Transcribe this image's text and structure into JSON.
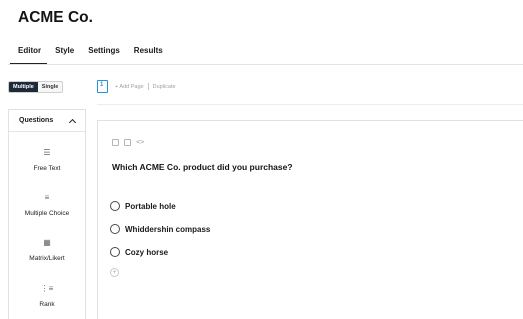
{
  "app": {
    "title": "ACME Co."
  },
  "tabs": [
    {
      "label": "Editor",
      "active": true
    },
    {
      "label": "Style",
      "active": false
    },
    {
      "label": "Settings",
      "active": false
    },
    {
      "label": "Results",
      "active": false
    }
  ],
  "mode_toggle": {
    "options": [
      {
        "label": "Multiple",
        "active": true
      },
      {
        "label": "Single",
        "active": false
      }
    ]
  },
  "page_bar": {
    "page_icon": "page-number-icon",
    "page_number": "1",
    "add_page_label": "+ Add Page",
    "duplicate_label": "Duplicate"
  },
  "sidebar": {
    "header": "Questions",
    "header_icon": "chevron-up-icon",
    "question_types": [
      {
        "label": "Free Text",
        "icon": "text-lines-icon"
      },
      {
        "label": "Multiple Choice",
        "icon": "list-icon"
      },
      {
        "label": "Matrix/Likert",
        "icon": "matrix-icon"
      },
      {
        "label": "Rank",
        "icon": "ranked-list-icon"
      }
    ]
  },
  "question": {
    "toolbar_icons": [
      "image-icon",
      "media-icon",
      "code-icon"
    ],
    "title": "Which ACME Co. product did you purchase?",
    "options": [
      {
        "label": "Portable hole"
      },
      {
        "label": "Whiddershin compass"
      },
      {
        "label": "Cozy horse"
      }
    ],
    "add_option_icon": "add-circle-icon"
  },
  "colors": {
    "accent": "#2a8fd6",
    "toggle_active": "#1e2a3a",
    "border": "#e1e1e1"
  }
}
